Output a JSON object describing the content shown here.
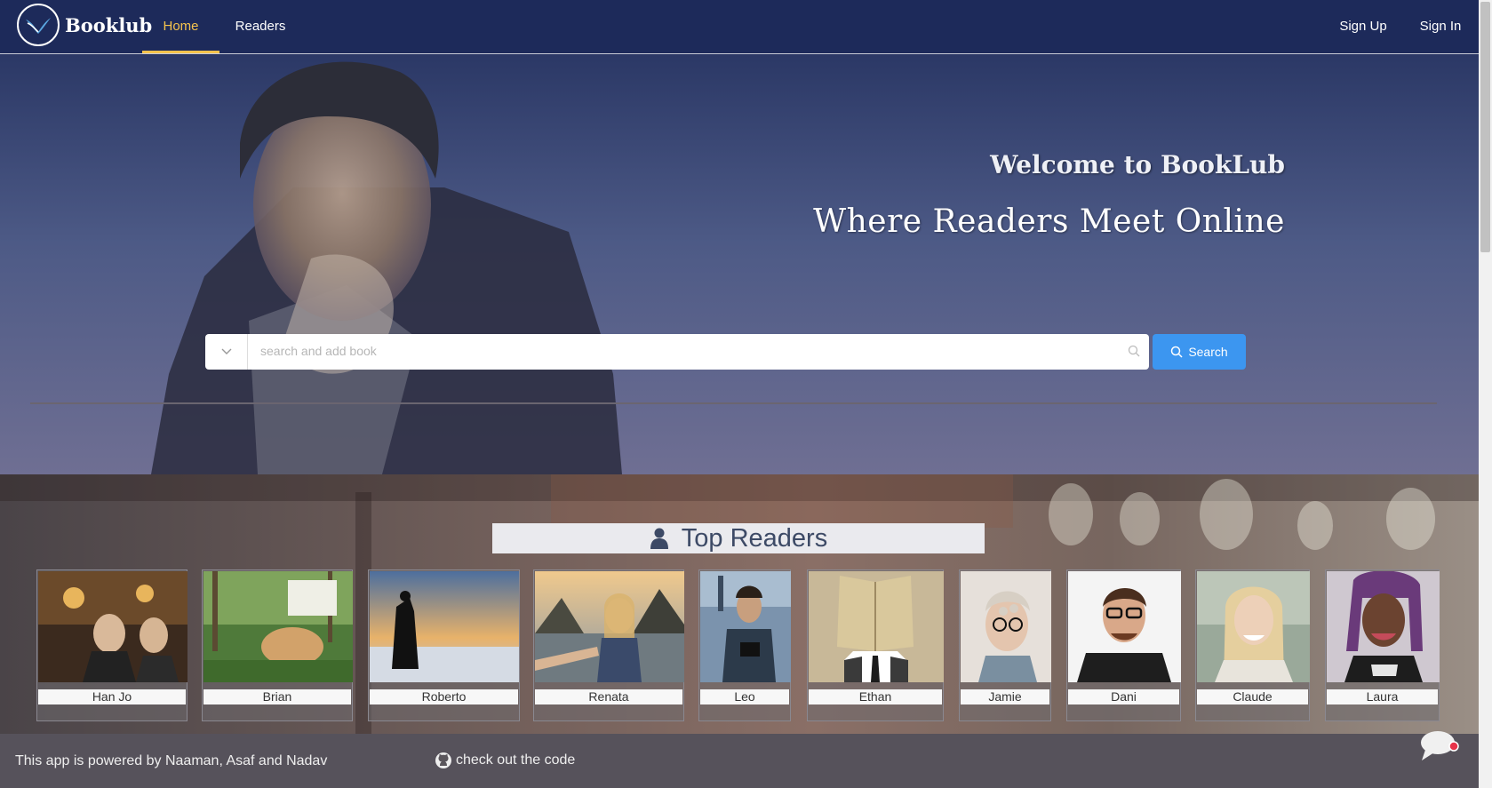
{
  "navbar": {
    "brand": "Booklub",
    "items": [
      {
        "label": "Home",
        "active": true
      },
      {
        "label": "Readers",
        "active": false
      }
    ],
    "sign_up": "Sign Up",
    "sign_in": "Sign In",
    "accent_color": "#f5c34d",
    "bg_color": "#1d2a5a"
  },
  "hero": {
    "welcome": "Welcome to BookLub",
    "tagline": "Where Readers Meet Online",
    "search": {
      "placeholder": "search and add book",
      "value": "",
      "button_label": "Search",
      "button_color": "#3c96f0"
    }
  },
  "top_readers": {
    "title": "Top Readers",
    "icon": "user-icon",
    "readers": [
      {
        "name": "Han Jo"
      },
      {
        "name": "Brian"
      },
      {
        "name": "Roberto"
      },
      {
        "name": "Renata"
      },
      {
        "name": "Leo"
      },
      {
        "name": "Ethan"
      },
      {
        "name": "Jamie"
      },
      {
        "name": "Dani"
      },
      {
        "name": "Claude"
      },
      {
        "name": "Laura"
      }
    ]
  },
  "footer": {
    "powered_by": "This app is powered by Naaman, Asaf and Nadav",
    "code_link": "check out the code",
    "code_icon": "github-icon",
    "chat_icon": "chat-bubble-icon"
  }
}
